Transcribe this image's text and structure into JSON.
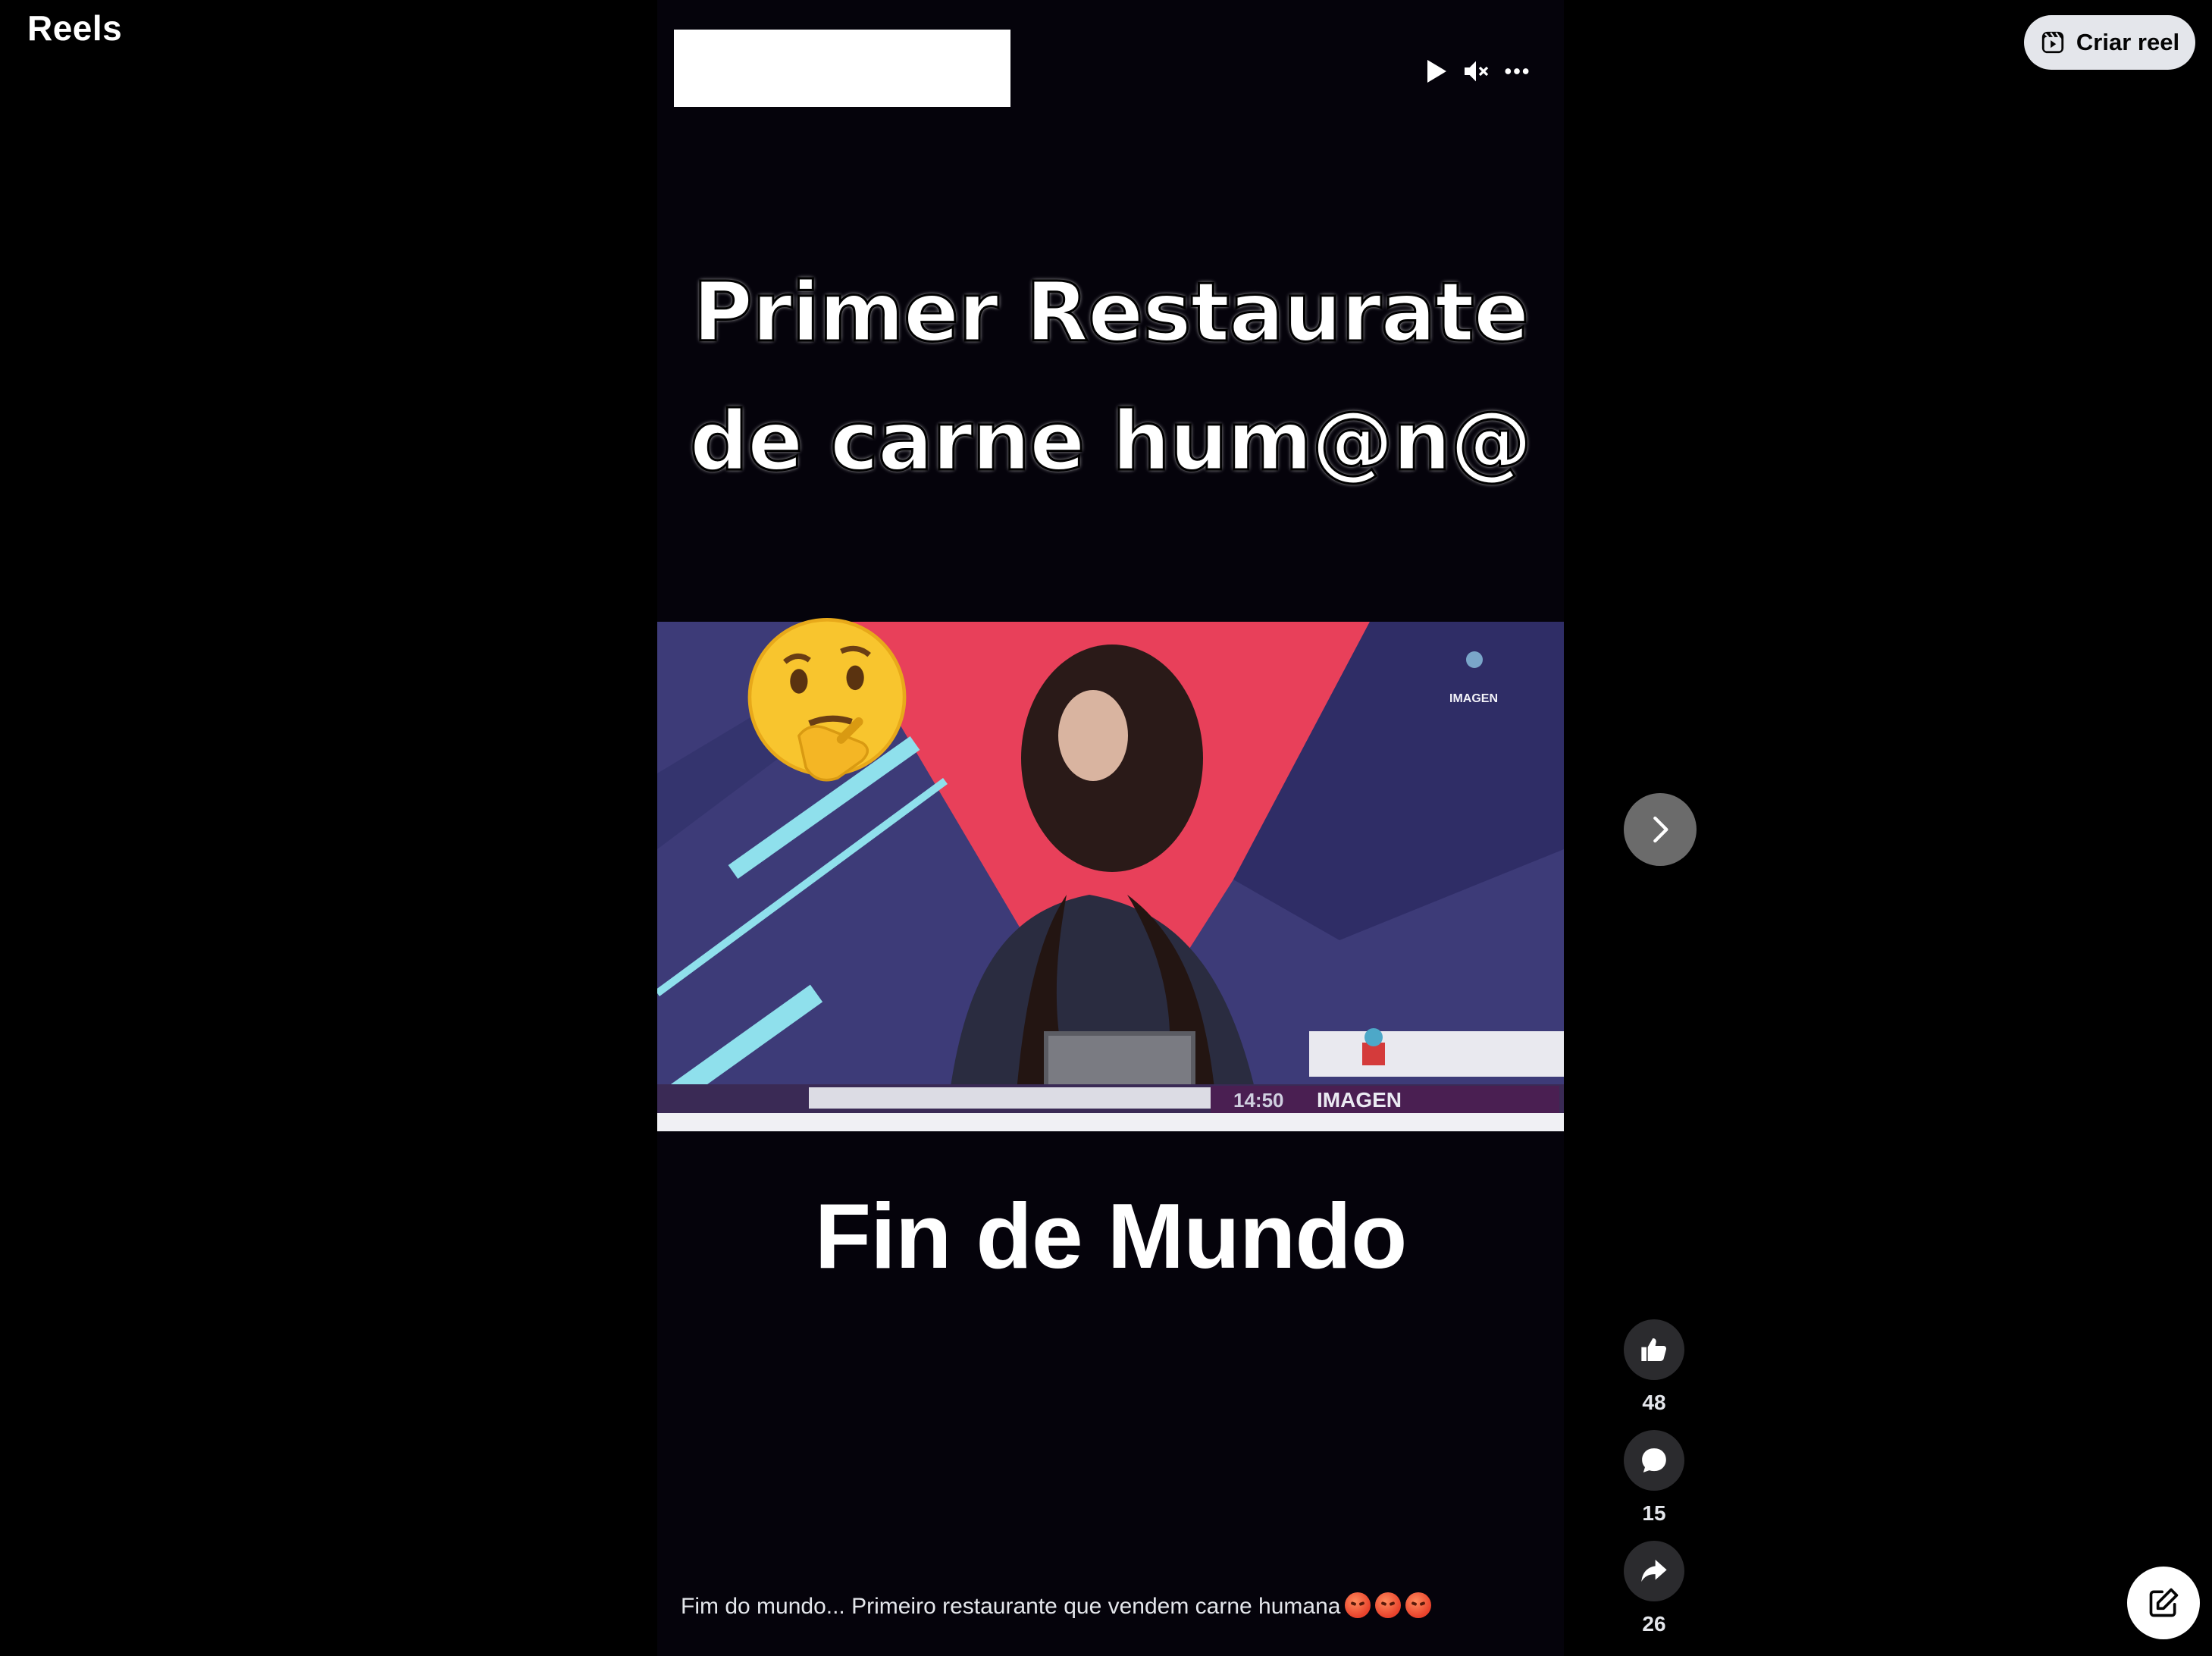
{
  "header": {
    "title": "Reels",
    "create_reel_label": "Criar reel"
  },
  "video": {
    "overlay_line1": "Primer Restaurate",
    "overlay_line2": "de carne hum@n@",
    "bottom_title": "Fin de Mundo",
    "news_channel_logo": "IMAGEN",
    "news_time": "14:50",
    "news_ticker_label": "IMAGEN",
    "controls": {
      "play_icon": "play-icon",
      "mute_icon": "muted-speaker-icon",
      "more_icon": "more-options-icon"
    }
  },
  "caption": {
    "text": "Fim do mundo... Primeiro restaurante que vendem carne humana",
    "emoji_count": 3
  },
  "actions": {
    "like_count": "48",
    "comment_count": "15",
    "share_count": "26"
  },
  "colors": {
    "background": "#000000",
    "button_light": "#e4e6eb",
    "action_circle": "#2b2b2e",
    "next_button": "#6b6b6b"
  }
}
